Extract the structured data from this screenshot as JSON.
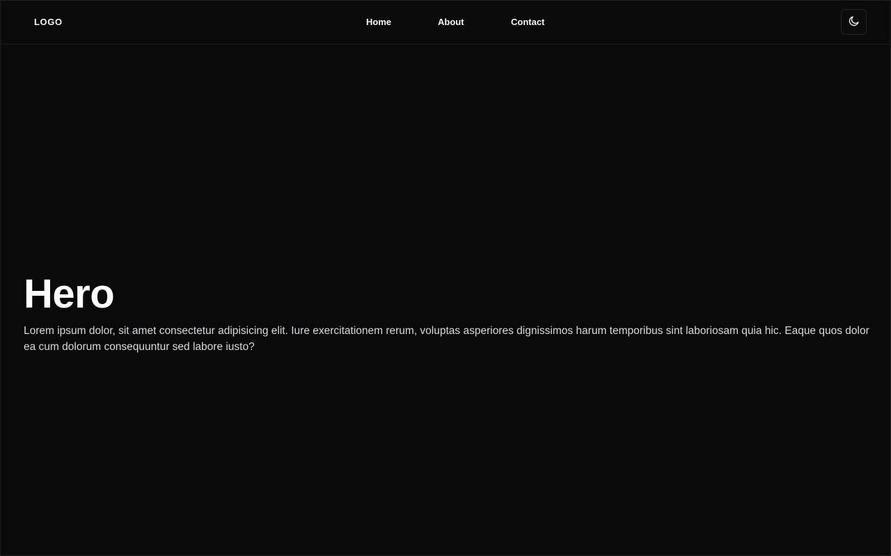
{
  "navbar": {
    "logo": "LOGO",
    "links": [
      {
        "label": "Home"
      },
      {
        "label": "About"
      },
      {
        "label": "Contact"
      }
    ],
    "theme_toggle_icon": "moon-icon"
  },
  "hero": {
    "title": "Hero",
    "body": "Lorem ipsum dolor, sit amet consectetur adipisicing elit. Iure exercitationem rerum, voluptas asperiores dignissimos harum temporibus sint laboriosam quia hic. Eaque quos dolor ea cum dolorum consequuntur sed labore iusto?"
  },
  "colors": {
    "background": "#0a0a0b",
    "text": "#f4f4f5",
    "border": "#1e1e21"
  }
}
